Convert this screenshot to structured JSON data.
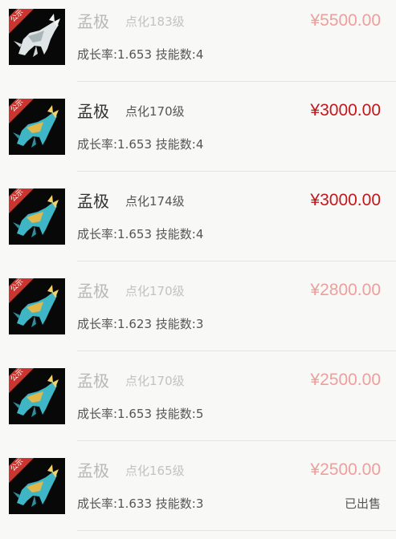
{
  "colors": {
    "price_active": "#c4161c",
    "price_dim": "#ec9f9c",
    "badge": "#c8362f"
  },
  "items": [
    {
      "name": "孟极",
      "level": "点化183级",
      "price": "¥5500.00",
      "stats": "成长率:1.653 技能数:4",
      "badge": "公示",
      "state": "dim",
      "icon": "silver-beast-icon",
      "status": ""
    },
    {
      "name": "孟极",
      "level": "点化170级",
      "price": "¥3000.00",
      "stats": "成长率:1.653 技能数:4",
      "badge": "公示",
      "state": "active",
      "icon": "cyan-beast-icon",
      "status": ""
    },
    {
      "name": "孟极",
      "level": "点化174级",
      "price": "¥3000.00",
      "stats": "成长率:1.653 技能数:4",
      "badge": "公示",
      "state": "active",
      "icon": "cyan-beast-icon",
      "status": ""
    },
    {
      "name": "孟极",
      "level": "点化170级",
      "price": "¥2800.00",
      "stats": "成长率:1.623 技能数:3",
      "badge": "公示",
      "state": "dim",
      "icon": "cyan-beast-icon",
      "status": ""
    },
    {
      "name": "孟极",
      "level": "点化170级",
      "price": "¥2500.00",
      "stats": "成长率:1.653 技能数:5",
      "badge": "公示",
      "state": "dim",
      "icon": "cyan-beast-icon",
      "status": ""
    },
    {
      "name": "孟极",
      "level": "点化165级",
      "price": "¥2500.00",
      "stats": "成长率:1.633 技能数:3",
      "badge": "公示",
      "state": "dim",
      "icon": "cyan-beast-icon",
      "status": "已出售"
    }
  ]
}
